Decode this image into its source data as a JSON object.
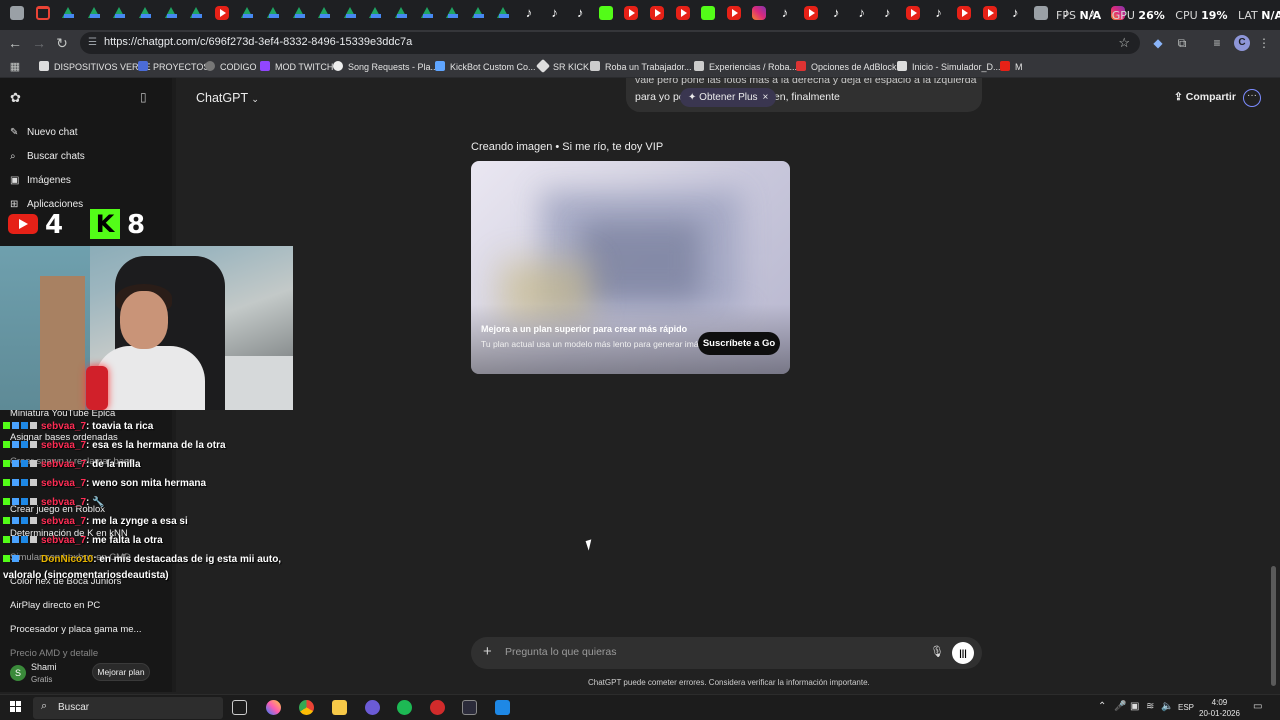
{
  "browser": {
    "url": "https://chatgpt.com/c/696f273d-3ef4-8332-8496-15339e3ddc7a",
    "bookmarks": [
      "DISPOSITIVOS VERSE",
      "PROYECTOS",
      "CODIGO",
      "MOD TWITCH",
      "Song Requests - Pla...",
      "KickBot Custom Co...",
      "SR KICK",
      "Roba un Trabajador...",
      "Experiencias / Roba...",
      "Opciones de AdBlock",
      "Inicio - Simulador_D...",
      "M"
    ],
    "profile_initial": "C"
  },
  "overlay_stats": {
    "fps_label": "FPS",
    "fps_value": "N/A",
    "gpu_label": "GPU",
    "gpu_value": "26%",
    "cpu_label": "CPU",
    "cpu_value": "19%",
    "lat_label": "LAT",
    "lat_value": "N/A"
  },
  "stream": {
    "youtube_viewers": "4",
    "kick_viewers": "8",
    "kick_logo": "K",
    "chat": [
      {
        "user": "sebvaa_7",
        "text": ": toavia ta rica"
      },
      {
        "user": "sebvaa_7",
        "text": ": esa es la hermana de la otra"
      },
      {
        "user": "sebvaa_7",
        "text": ": de la milla"
      },
      {
        "user": "sebvaa_7",
        "text": ": weno son mita hermana"
      },
      {
        "user": "sebvaa_7",
        "text": ": 🔧"
      },
      {
        "user": "sebvaa_7",
        "text": ": me la zynge a esa si"
      },
      {
        "user": "sebvaa_7",
        "text": ": me falta la otra"
      },
      {
        "user": "DonNico10",
        "text": ": en mis destacadas de ig esta mii auto,"
      },
      {
        "user": "",
        "text": "valoralo (sincomentariosdeautista)"
      }
    ]
  },
  "sidebar": {
    "new_chat": "Nuevo chat",
    "search_chats": "Buscar chats",
    "images": "Imágenes",
    "apps": "Aplicaciones",
    "history": [
      "Miniatura YouTube Épica",
      "Asignar bases ordenadas",
      "Crear spawn y reclamar base",
      "Crear juego en Roblox",
      "Determinación de K en kNN",
      "Simular con haxbox en CMD",
      "Color hex de Boca Juniors",
      "AirPlay directo en PC",
      "Procesador y placa gama me...",
      "Precio AMD y detalle"
    ],
    "user_name": "Shami",
    "user_plan": "Gratis",
    "user_initial": "S",
    "upgrade": "Mejorar plan"
  },
  "main": {
    "model": "ChatGPT",
    "share": "Compartir",
    "user_message_line1": "vale pero pone las fotos mas a la derecha y deja el espacio a la izquierda",
    "user_message_line2": "para yo poner mi cara y tambien, finalmente",
    "plus_pill": "Obtener Plus",
    "creating_label": "Creando imagen • Si me río, te doy VIP",
    "upsell_title": "Mejora a un plan superior para crear más rápido",
    "upsell_sub": "Tu plan actual usa un modelo más lento para generar imágenes.",
    "subscribe_button": "Suscríbete a Go",
    "composer_placeholder": "Pregunta lo que quieras",
    "disclaimer": "ChatGPT puede cometer errores. Considera verificar la información importante."
  },
  "taskbar": {
    "search": "Buscar",
    "lang": "ESP",
    "time": "4:09",
    "date": "20-01-2026"
  }
}
